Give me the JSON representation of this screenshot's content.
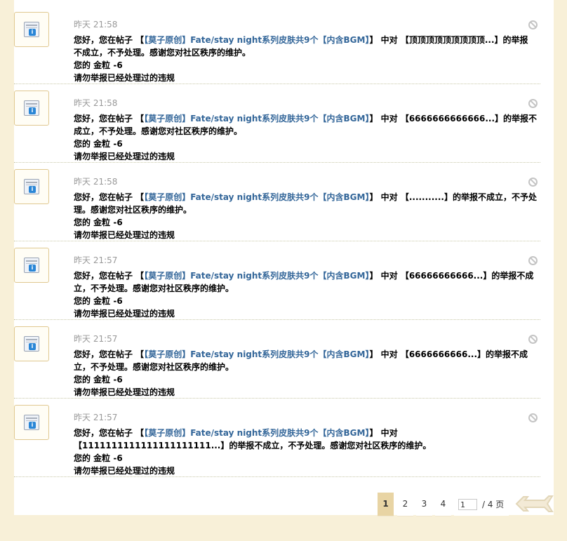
{
  "pagination": {
    "pages": [
      "1",
      "2",
      "3",
      "4"
    ],
    "current": "1",
    "input_value": "1",
    "total_text": "/ 4 页"
  },
  "notices": [
    {
      "time": "昨天 21:58",
      "line1_prefix": "您好，您在帖子 【",
      "thread_title": "【莫子原创】Fate/stay night系列皮肤共9个【内含BGM】",
      "line1_mid": "】 中对 【顶顶顶顶顶顶顶顶顶...】的举报",
      "line2": "不成立，不予处理。感谢您对社区秩序的维护。",
      "line3": "您的 金粒 -6",
      "line4": "请勿举报已经处理过的违规"
    },
    {
      "time": "昨天 21:58",
      "line1_prefix": "您好，您在帖子 【",
      "thread_title": "【莫子原创】Fate/stay night系列皮肤共9个【内含BGM】",
      "line1_mid": "】 中对 【6666666666666...】的举报不",
      "line2": "成立，不予处理。感谢您对社区秩序的维护。",
      "line3": "您的 金粒 -6",
      "line4": "请勿举报已经处理过的违规"
    },
    {
      "time": "昨天 21:58",
      "line1_prefix": "您好，您在帖子 【",
      "thread_title": "【莫子原创】Fate/stay night系列皮肤共9个【内含BGM】",
      "line1_mid": "】 中对 【...........】的举报不成立，不予处",
      "line2": "理。感谢您对社区秩序的维护。",
      "line3": "您的 金粒 -6",
      "line4": "请勿举报已经处理过的违规"
    },
    {
      "time": "昨天 21:57",
      "line1_prefix": "您好，您在帖子 【",
      "thread_title": "【莫子原创】Fate/stay night系列皮肤共9个【内含BGM】",
      "line1_mid": "】 中对 【66666666666...】的举报不成",
      "line2": "立，不予处理。感谢您对社区秩序的维护。",
      "line3": "您的 金粒 -6",
      "line4": "请勿举报已经处理过的违规"
    },
    {
      "time": "昨天 21:57",
      "line1_prefix": "您好，您在帖子 【",
      "thread_title": "【莫子原创】Fate/stay night系列皮肤共9个【内含BGM】",
      "line1_mid": "】 中对 【6666666666...】的举报不成",
      "line2": "立，不予处理。感谢您对社区秩序的维护。",
      "line3": "您的 金粒 -6",
      "line4": "请勿举报已经处理过的违规"
    },
    {
      "time": "昨天 21:57",
      "line1_prefix": "您好，您在帖子 【",
      "thread_title": "【莫子原创】Fate/stay night系列皮肤共9个【内含BGM】",
      "line1_mid": "】 中对",
      "line2": "【1111111111111111111111...】的举报不成立，不予处理。感谢您对社区秩序的维护。",
      "line3": "您的 金粒 -6",
      "line4": "请勿举报已经处理过的违规"
    }
  ]
}
